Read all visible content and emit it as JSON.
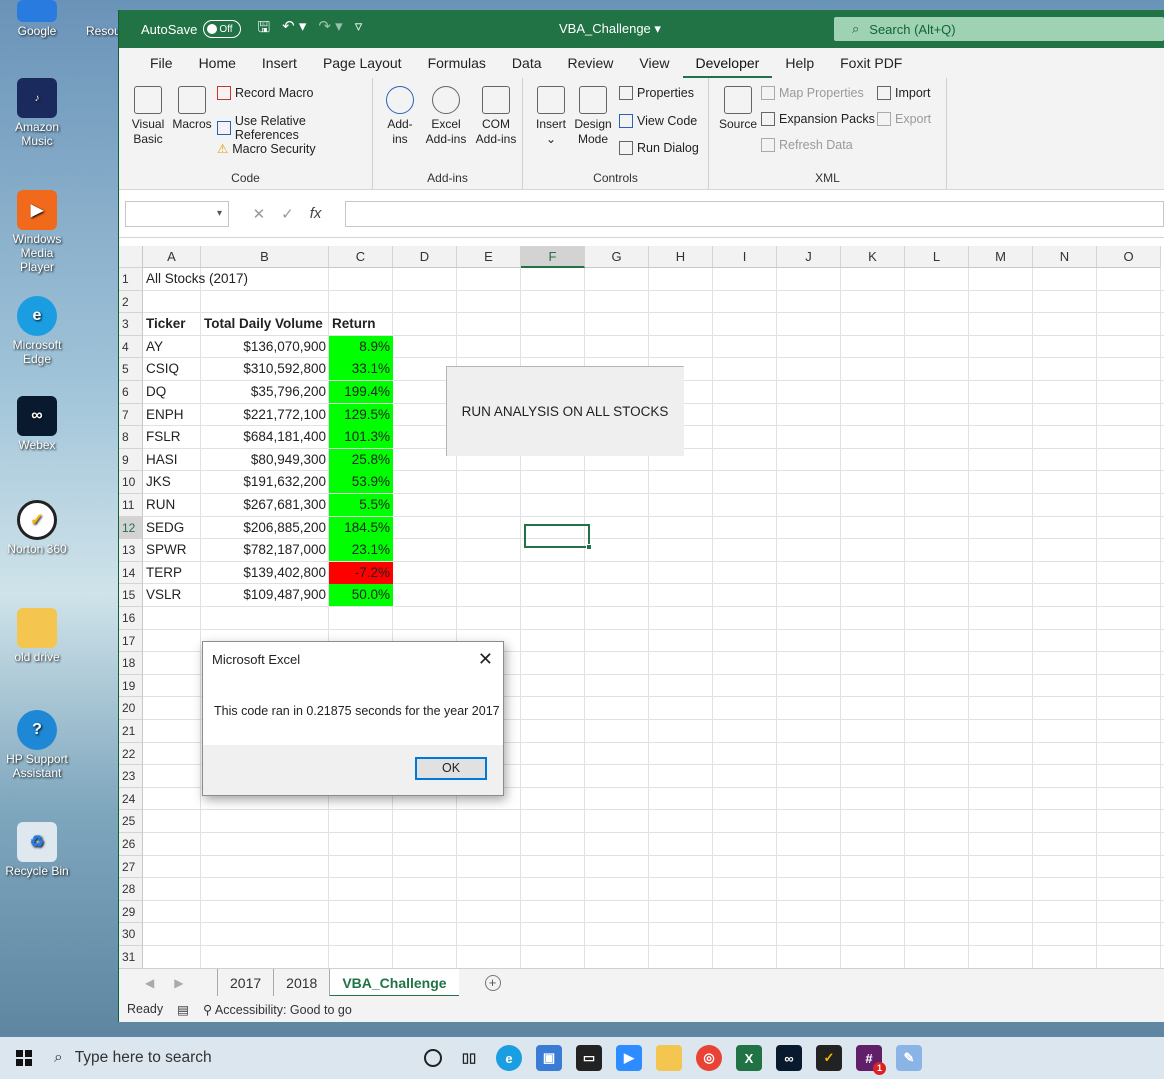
{
  "desktop": {
    "icons": [
      {
        "label": "Google"
      },
      {
        "label": "Amazon Music"
      },
      {
        "label": "Windows Media Player"
      },
      {
        "label": "Microsoft Edge"
      },
      {
        "label": "Webex"
      },
      {
        "label": "Norton 360"
      },
      {
        "label": "old drive"
      },
      {
        "label": "HP Support Assistant"
      },
      {
        "label": "Recycle Bin"
      }
    ],
    "peek_label": "Resou"
  },
  "titlebar": {
    "autosave_label": "AutoSave",
    "autosave_state": "Off",
    "doc_title": "VBA_Challenge ▾",
    "search_placeholder": "Search (Alt+Q)"
  },
  "menu": [
    "File",
    "Home",
    "Insert",
    "Page Layout",
    "Formulas",
    "Data",
    "Review",
    "View",
    "Developer",
    "Help",
    "Foxit PDF"
  ],
  "ribbon": {
    "code": {
      "visual_basic": "Visual Basic",
      "macros": "Macros",
      "record_macro": "Record Macro",
      "relative_refs": "Use Relative References",
      "macro_security": "Macro Security",
      "label": "Code"
    },
    "addins": {
      "addins": "Add-ins",
      "excel_addins": "Excel Add-ins",
      "com_addins": "COM Add-ins",
      "label": "Add-ins"
    },
    "controls": {
      "insert": "Insert",
      "design_mode": "Design Mode",
      "properties": "Properties",
      "view_code": "View Code",
      "run_dialog": "Run Dialog",
      "label": "Controls"
    },
    "xml": {
      "source": "Source",
      "map_properties": "Map Properties",
      "expansion_packs": "Expansion Packs",
      "refresh_data": "Refresh Data",
      "import": "Import",
      "export": "Export",
      "label": "XML"
    }
  },
  "columns": [
    "A",
    "B",
    "C",
    "D",
    "E",
    "F",
    "G",
    "H",
    "I",
    "J",
    "K",
    "L",
    "M",
    "N",
    "O"
  ],
  "sheet": {
    "title": "All Stocks (2017)",
    "headers": [
      "Ticker",
      "Total Daily Volume",
      "Return"
    ],
    "rows": [
      {
        "ticker": "AY",
        "volume": "$136,070,900",
        "return": "8.9%",
        "status": "positive"
      },
      {
        "ticker": "CSIQ",
        "volume": "$310,592,800",
        "return": "33.1%",
        "status": "positive"
      },
      {
        "ticker": "DQ",
        "volume": "$35,796,200",
        "return": "199.4%",
        "status": "positive"
      },
      {
        "ticker": "ENPH",
        "volume": "$221,772,100",
        "return": "129.5%",
        "status": "positive"
      },
      {
        "ticker": "FSLR",
        "volume": "$684,181,400",
        "return": "101.3%",
        "status": "positive"
      },
      {
        "ticker": "HASI",
        "volume": "$80,949,300",
        "return": "25.8%",
        "status": "positive"
      },
      {
        "ticker": "JKS",
        "volume": "$191,632,200",
        "return": "53.9%",
        "status": "positive"
      },
      {
        "ticker": "RUN",
        "volume": "$267,681,300",
        "return": "5.5%",
        "status": "positive"
      },
      {
        "ticker": "SEDG",
        "volume": "$206,885,200",
        "return": "184.5%",
        "status": "positive"
      },
      {
        "ticker": "SPWR",
        "volume": "$782,187,000",
        "return": "23.1%",
        "status": "positive"
      },
      {
        "ticker": "TERP",
        "volume": "$139,402,800",
        "return": "-7.2%",
        "status": "negative"
      },
      {
        "ticker": "VSLR",
        "volume": "$109,487,900",
        "return": "50.0%",
        "status": "positive"
      }
    ],
    "run_button": "RUN ANALYSIS ON ALL STOCKS",
    "colors": {
      "positive": "#00ff00",
      "negative": "#ff0000",
      "accent": "#217346"
    }
  },
  "dialog": {
    "title": "Microsoft Excel",
    "message": "This code ran in 0.21875 seconds for the year 2017",
    "ok": "OK"
  },
  "tabs": [
    "2017",
    "2018",
    "VBA_Challenge"
  ],
  "status": {
    "ready": "Ready",
    "accessibility": "Accessibility: Good to go"
  },
  "taskbar": {
    "search_placeholder": "Type here to search",
    "notification_count": "1"
  }
}
